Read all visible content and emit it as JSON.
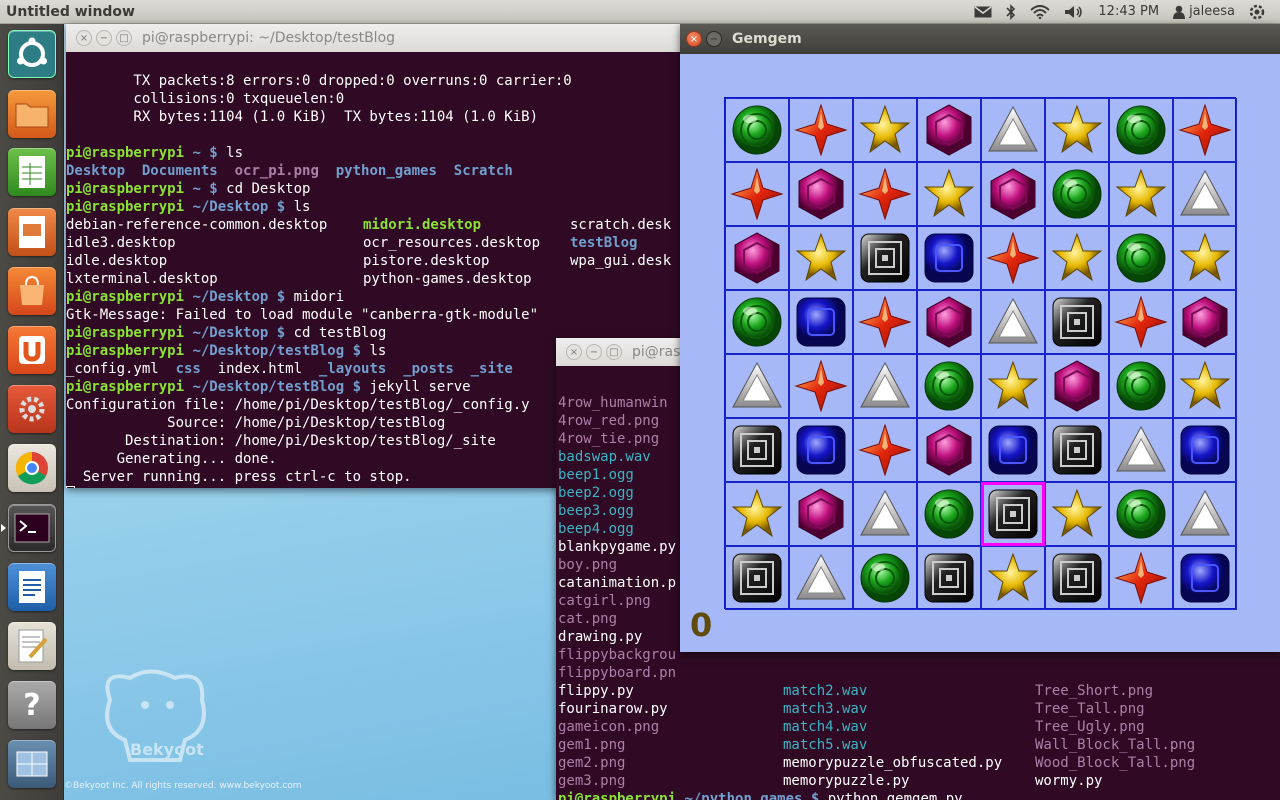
{
  "top_panel": {
    "title": "Untitled window",
    "time": "12:43 PM",
    "user": "jaleesa"
  },
  "wallpaper": {
    "copyright": "©Bekyoot Inc.  All rights reserved.  www.bekyoot.com",
    "logo_text": "Bekyoot"
  },
  "launcher": {
    "items": [
      "ubuntu-dash",
      "files",
      "libreoffice-calc",
      "libreoffice-impress",
      "software-center",
      "ubuntu-one",
      "system-settings",
      "chrome",
      "terminal",
      "libreoffice-writer",
      "text-editor",
      "help",
      "workspaces",
      "trash"
    ]
  },
  "terminal1": {
    "title": "pi@raspberrypi: ~/Desktop/testBlog",
    "lines": [
      "        TX packets:8 errors:0 dropped:0 overruns:0 carrier:0",
      "        collisions:0 txqueuelen:0",
      "        RX bytes:1104 (1.0 KiB)  TX bytes:1104 (1.0 KiB)",
      ""
    ],
    "prompt_user": "pi@raspberrypi",
    "cmd_ls": "ls",
    "home_dirs": [
      "Desktop",
      "Documents",
      "ocr_pi.png",
      "python_games",
      "Scratch"
    ],
    "cmd_cd_desktop": "cd Desktop",
    "desktop_files": [
      [
        "debian-reference-common.desktop",
        "midori.desktop",
        "scratch.desk"
      ],
      [
        "idle3.desktop",
        "ocr_resources.desktop",
        "testBlog"
      ],
      [
        "idle.desktop",
        "pistore.desktop",
        "wpa_gui.desk"
      ],
      [
        "lxterminal.desktop",
        "python-games.desktop",
        ""
      ]
    ],
    "cmd_midori": "midori",
    "gtk_msg": "Gtk-Message: Failed to load module \"canberra-gtk-module\"",
    "cmd_cd_blog": "cd testBlog",
    "blog_files": [
      "_config.yml",
      "css",
      "index.html",
      "_layouts",
      "_posts",
      "_site"
    ],
    "cmd_jekyll": "jekyll serve",
    "jekyll_out": [
      "Configuration file: /home/pi/Desktop/testBlog/_config.y",
      "            Source: /home/pi/Desktop/testBlog",
      "       Destination: /home/pi/Desktop/testBlog/_site",
      "      Generating... done.",
      "  Server running... press ctrl-c to stop."
    ]
  },
  "terminal2": {
    "title": "pi@rasp",
    "col1": [
      "4row_humanwin",
      "4row_red.png",
      "4row_tie.png",
      "badswap.wav",
      "beep1.ogg",
      "beep2.ogg",
      "beep3.ogg",
      "beep4.ogg",
      "blankpygame.py",
      "boy.png",
      "catanimation.p",
      "catgirl.png",
      "cat.png",
      "drawing.py",
      "flippybackgrou",
      "flippyboard.pn",
      "flippy.py",
      "fourinarow.py",
      "gameicon.png",
      "gem1.png",
      "gem2.png",
      "gem3.png"
    ],
    "col2": [
      "match2.wav",
      "match3.wav",
      "match4.wav",
      "match5.wav",
      "memorypuzzle_obfuscated.py",
      "memorypuzzle.py"
    ],
    "col3": [
      "Tree_Short.png",
      "Tree_Tall.png",
      "Tree_Ugly.png",
      "Wall_Block_Tall.png",
      "Wood_Block_Tall.png",
      "wormy.py"
    ],
    "prompt_path": "~/python_games $",
    "cmd": "python gemgem.py"
  },
  "gemgem": {
    "title": "Gemgem",
    "score": "0",
    "board": [
      [
        "green",
        "red",
        "star",
        "magenta",
        "white",
        "star",
        "green",
        "red"
      ],
      [
        "red",
        "magenta",
        "red",
        "star",
        "magenta",
        "green",
        "star",
        "white"
      ],
      [
        "magenta",
        "star",
        "black",
        "blue",
        "red",
        "star",
        "green",
        "star"
      ],
      [
        "green",
        "blue",
        "red",
        "magenta",
        "white",
        "black",
        "red",
        "magenta"
      ],
      [
        "white",
        "red",
        "white",
        "green",
        "star",
        "magenta",
        "green",
        "star"
      ],
      [
        "black",
        "blue",
        "red",
        "magenta",
        "blue",
        "black",
        "white",
        "blue"
      ],
      [
        "star",
        "magenta",
        "white",
        "green",
        "black",
        "star",
        "green",
        "white"
      ],
      [
        "black",
        "white",
        "green",
        "black",
        "star",
        "black",
        "red",
        "blue"
      ]
    ],
    "selected": "row 7, column 5"
  },
  "colors": {
    "terminal_bg": "#300a24",
    "prompt_green": "#8ae234",
    "dir_blue": "#729fcf",
    "gem_board_bg": "#a7b8f9",
    "selection": "#ff00ff"
  }
}
